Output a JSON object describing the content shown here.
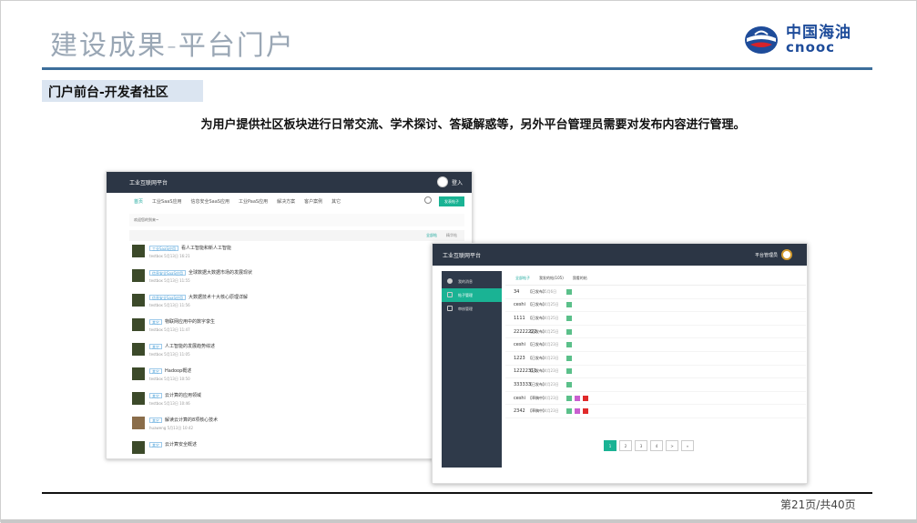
{
  "slide": {
    "title": "建设成果-平台门户",
    "section": "门户前台-开发者社区",
    "description": "为用户提供社区板块进行日常交流、学术探讨、答疑解惑等，另外平台管理员需要对发布内容进行管理。",
    "page": "第21页/共40页"
  },
  "logo": {
    "cn": "中国海油",
    "en": "cnooc"
  },
  "colors": {
    "accent": "#1ab394",
    "header": "#2c3645",
    "title": "#9aa7b5",
    "brand": "#1e4c9a"
  },
  "portal": {
    "app_title": "工业互联网平台",
    "login": "登入",
    "nav": [
      "首页",
      "工业SaaS应用",
      "信息安全SaaS应用",
      "工业PaaS应用",
      "解决方案",
      "客户案例",
      "其它"
    ],
    "ask_btn": "发表帖子",
    "breadcrumb": "欢迎您的到来~",
    "tab_a": "全部帖",
    "tab_b": "精华帖",
    "posts": [
      {
        "badge": "工业SaaS应用",
        "title": "看人工智能和新人工智能",
        "meta": "testbox 5月13日 16:21"
      },
      {
        "badge": "信息安全SaaS应用",
        "title": "全球数据大数据市场的发展现状",
        "meta": "testbox 5月13日 11:55"
      },
      {
        "badge": "信息安全SaaS应用",
        "title": "大数据技术十大核心原理详解",
        "meta": "testbox 5月13日 11:56"
      },
      {
        "badge": "其它",
        "title": "物联网应用中的数字孪生",
        "meta": "testbox 5月13日 11:47"
      },
      {
        "badge": "其它",
        "title": "人工智能的发展趋势综述",
        "meta": "testbox 5月13日 11:05"
      },
      {
        "badge": "其它",
        "title": "Hadoop概述",
        "meta": "testbox 5月13日 10:50"
      },
      {
        "badge": "其它",
        "title": "云计算的应用领域",
        "meta": "testbox 5月13日 10:46"
      },
      {
        "badge": "其它",
        "title": "解读云计算的8项核心技术",
        "meta": "huaweng 5月13日 10:42"
      },
      {
        "badge": "其它",
        "title": "云计算安全概述",
        "meta": ""
      }
    ]
  },
  "admin": {
    "app_title": "工业互联网平台",
    "user": "平台管理员",
    "sidebar": [
      "我的消息",
      "帖子管理",
      "审核管理"
    ],
    "tabs": [
      "全部帖子",
      "我发的帖(105)",
      "我看的帖"
    ],
    "rows": [
      {
        "name": "34",
        "state": "【已发布】",
        "date": "5月6日"
      },
      {
        "name": "ceshi",
        "state": "【已发布】",
        "date": "4月25日"
      },
      {
        "name": "1111",
        "state": "【已发布】",
        "date": "4月25日"
      },
      {
        "name": "22222222",
        "state": "【已发布】",
        "date": "4月25日"
      },
      {
        "name": "ceshi",
        "state": "【已发布】",
        "date": "4月23日"
      },
      {
        "name": "1223",
        "state": "【已发布】",
        "date": "4月23日"
      },
      {
        "name": "12222311",
        "state": "【已发布】",
        "date": "4月23日"
      },
      {
        "name": "333333",
        "state": "【已发布】",
        "date": "4月23日"
      },
      {
        "name": "ceshi",
        "state": "【草稿中】",
        "date": "4月23日"
      },
      {
        "name": "2342",
        "state": "【草稿中】",
        "date": "4月23日"
      }
    ],
    "pager": [
      "1",
      "2",
      "3",
      "4",
      ">",
      "»"
    ]
  }
}
